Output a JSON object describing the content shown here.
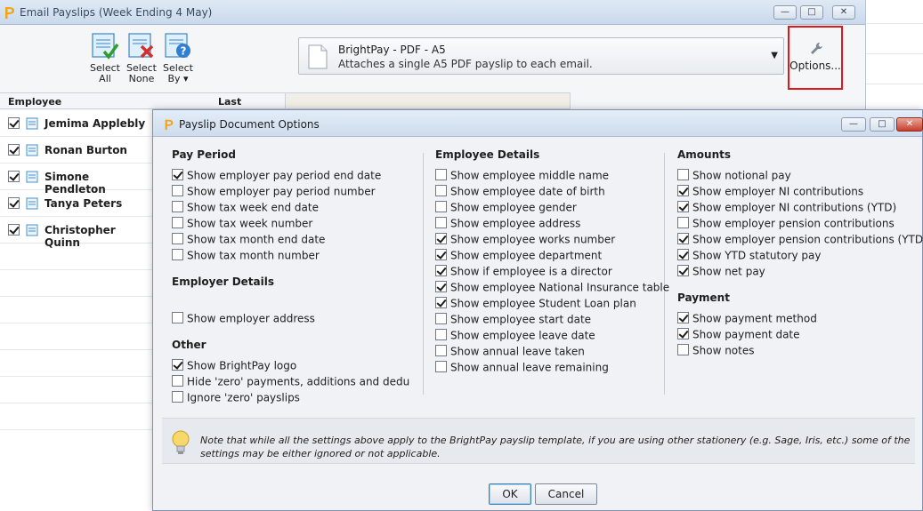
{
  "back_window": {
    "title": "Email Payslips (Week Ending 4 May)",
    "toolbar": {
      "select_all": [
        "Select",
        "All"
      ],
      "select_none": [
        "Select",
        "None"
      ],
      "select_by": [
        "Select",
        "By ▾"
      ]
    },
    "stationery": {
      "title": "BrightPay - PDF - A5",
      "description": "Attaches a single A5 PDF payslip to each email."
    },
    "options_label": "Options...",
    "columns": {
      "employee": "Employee",
      "last_emailed": "Last Emailed"
    },
    "employees": [
      {
        "name": "Jemima Applebly",
        "checked": true
      },
      {
        "name": "Ronan Burton",
        "checked": true
      },
      {
        "name": "Simone Pendleton",
        "checked": true
      },
      {
        "name": "Tanya Peters",
        "checked": true
      },
      {
        "name": "Christopher Quinn",
        "checked": true
      }
    ]
  },
  "dialog": {
    "title": "Payslip Document Options",
    "pay_period": {
      "heading": "Pay Period",
      "options": [
        {
          "label": "Show employer pay period end date",
          "checked": true
        },
        {
          "label": "Show employer pay period number",
          "checked": false
        },
        {
          "label": "Show tax week end date",
          "checked": false
        },
        {
          "label": "Show tax week number",
          "checked": false
        },
        {
          "label": "Show tax month end date",
          "checked": false
        },
        {
          "label": "Show tax month number",
          "checked": false
        }
      ]
    },
    "employer_details": {
      "heading": "Employer Details",
      "options": [
        {
          "label": "Show employer address",
          "checked": false
        }
      ]
    },
    "other": {
      "heading": "Other",
      "options": [
        {
          "label": "Show BrightPay logo",
          "checked": true
        },
        {
          "label": "Hide 'zero' payments, additions and deductions",
          "checked": false
        },
        {
          "label": "Ignore 'zero' payslips",
          "checked": false
        }
      ]
    },
    "employee_details": {
      "heading": "Employee Details",
      "options": [
        {
          "label": "Show employee middle name",
          "checked": false
        },
        {
          "label": "Show employee date of birth",
          "checked": false
        },
        {
          "label": "Show employee gender",
          "checked": false
        },
        {
          "label": "Show employee address",
          "checked": false
        },
        {
          "label": "Show employee works number",
          "checked": true
        },
        {
          "label": "Show employee department",
          "checked": true
        },
        {
          "label": "Show if employee is a director",
          "checked": true
        },
        {
          "label": "Show employee National Insurance table",
          "checked": true
        },
        {
          "label": "Show employee Student Loan plan",
          "checked": true
        },
        {
          "label": "Show employee start date",
          "checked": false
        },
        {
          "label": "Show employee leave date",
          "checked": false
        },
        {
          "label": "Show annual leave taken",
          "checked": false
        },
        {
          "label": "Show annual leave remaining",
          "checked": false
        }
      ]
    },
    "amounts": {
      "heading": "Amounts",
      "options": [
        {
          "label": "Show notional pay",
          "checked": false
        },
        {
          "label": "Show employer NI contributions",
          "checked": true
        },
        {
          "label": "Show employer NI contributions (YTD)",
          "checked": true
        },
        {
          "label": "Show employer pension contributions",
          "checked": false
        },
        {
          "label": "Show employer pension contributions (YTD)",
          "checked": true
        },
        {
          "label": "Show YTD statutory pay",
          "checked": true
        },
        {
          "label": "Show net pay",
          "checked": true
        }
      ]
    },
    "payment": {
      "heading": "Payment",
      "options": [
        {
          "label": "Show payment method",
          "checked": true
        },
        {
          "label": "Show payment date",
          "checked": true
        },
        {
          "label": "Show notes",
          "checked": false
        }
      ]
    },
    "note": "Note that while all the settings above apply to the BrightPay payslip template, if you are using other stationery (e.g. Sage, Iris, etc.) some of the settings may be either ignored or not applicable.",
    "ok_label": "OK",
    "cancel_label": "Cancel"
  },
  "icons": {
    "app_logo": "brightpay-logo-icon",
    "window_controls": [
      "minimize-icon",
      "maximize-icon",
      "close-icon"
    ],
    "tip": "lightbulb-icon",
    "options": "wrench-icon",
    "payslip": "payslip-icon"
  },
  "colors": {
    "highlight_border": "#e0161a",
    "title_bar": "#cddcee",
    "close_button": "#c7402d"
  }
}
